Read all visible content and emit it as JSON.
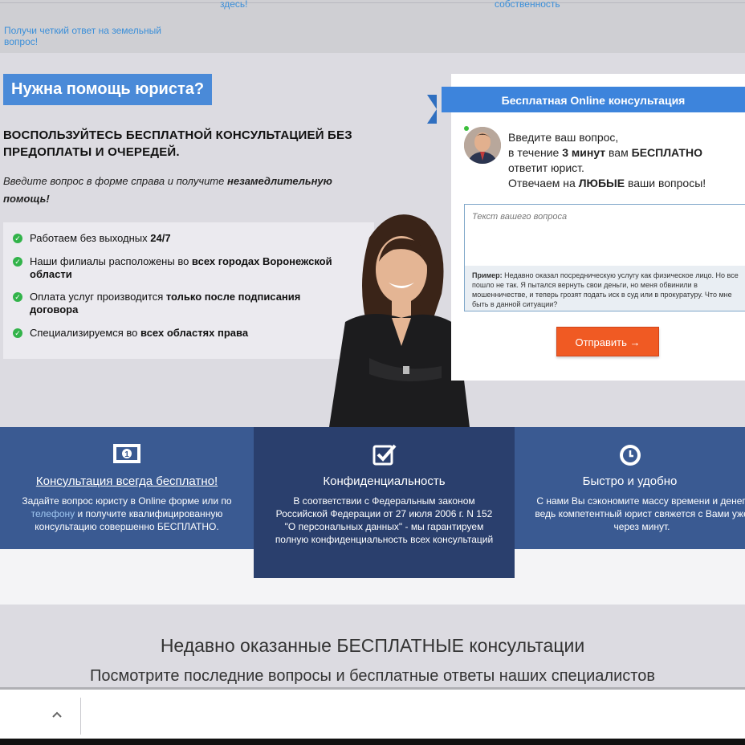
{
  "top": {
    "cut_link_1": "здесь!",
    "cut_link_2": "собственность",
    "land_link": "Получи четкий ответ на земельный вопрос!"
  },
  "hero": {
    "badge": "Нужна помощь юриста?",
    "headline": "ВОСПОЛЬЗУЙТЕСЬ БЕСПЛАТНОЙ КОНСУЛЬТАЦИЕЙ БЕЗ ПРЕДОПЛАТЫ И ОЧЕРЕДЕЙ.",
    "intro_plain": "Введите вопрос в форме справа и получите ",
    "intro_bold": "незамедлительную помощь!",
    "features": [
      {
        "plain": "Работаем без выходных ",
        "bold": "24/7"
      },
      {
        "plain": "Наши филиалы расположены во ",
        "bold": "всех городах Воронежской области"
      },
      {
        "plain": "Оплата услуг производится ",
        "bold": "только после подписания договора"
      },
      {
        "plain": "Специализируемся во ",
        "bold": "всех областях права"
      }
    ]
  },
  "form": {
    "ribbon": "Бесплатная Online консультация",
    "line1": "Введите ваш вопрос,",
    "line2_a": "в течение ",
    "line2_b": "3 минут",
    "line2_c": " вам ",
    "line2_d": "БЕСПЛАТНО",
    "line3": "ответит юрист.",
    "line4_a": "Отвечаем на ",
    "line4_b": "ЛЮБЫЕ",
    "line4_c": " ваши вопросы!",
    "placeholder": "Текст вашего вопроса",
    "example_label": "Пример:",
    "example_text": " Недавно оказал посредническую услугу как физическое лицо. Но все пошло не так. Я пытался вернуть свои деньги, но меня обвинили в мошенничестве, и теперь грозят подать иск в суд или в прокуратуру. Что мне быть в данной ситуации?",
    "submit": "Отправить →"
  },
  "benefits": [
    {
      "title": "Консультация всегда бесплатно!",
      "text_a": "Задайте вопрос юристу в Online форме или по ",
      "link": "телефону",
      "text_b": " и получите квалифицированную консультацию совершенно БЕСПЛАТНО."
    },
    {
      "title": "Конфиденциальность",
      "text": "В соответствии с Федеральным законом Российской Федерации от 27 июля 2006 г. N 152 \"О персональных данных\" - мы гарантируем полную конфиденциальность всех консультаций"
    },
    {
      "title": "Быстро и удобно",
      "text": "С нами Вы сэкономите массу времени и денег, ведь компетентный юрист свяжется с Вами уже через минут."
    }
  ],
  "recent": {
    "title": "Недавно оказанные БЕСПЛАТНЫЕ консультации",
    "subtitle": "Посмотрите последние вопросы и бесплатные ответы наших специалистов"
  },
  "icons": [
    "money-icon",
    "checkbox-icon",
    "clock-icon",
    "chevron-up-icon"
  ],
  "colors": {
    "accent": "#4a8ad8",
    "submit": "#f05a23",
    "band": "#3a5a92",
    "band_dark": "#2a3f6d",
    "check": "#32b34a"
  }
}
